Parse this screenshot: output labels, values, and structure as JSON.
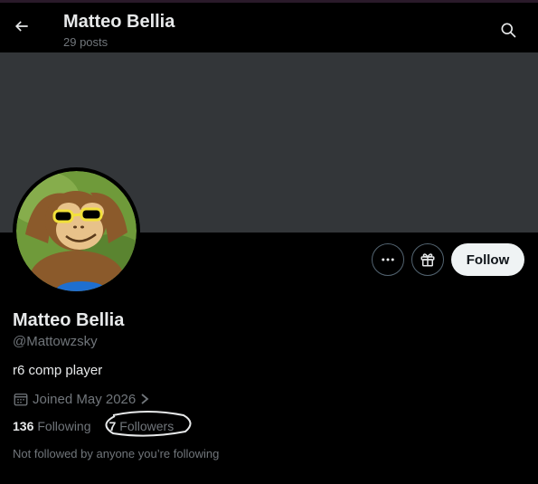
{
  "header": {
    "title": "Matteo Bellia",
    "post_count": "29 posts"
  },
  "profile": {
    "name": "Matteo Bellia",
    "handle": "@Mattowzsky",
    "bio": "r6 comp player",
    "joined": "Joined May 2026",
    "following_count": "136",
    "following_label": "Following",
    "followers_count": "7",
    "followers_label": "Followers",
    "not_followed_text": "Not followed by anyone you’re following"
  },
  "actions": {
    "follow_label": "Follow"
  },
  "icons": {
    "back": "arrow-left-icon",
    "search": "search-icon",
    "more": "more-dots-icon",
    "gift": "gift-icon",
    "calendar": "calendar-icon",
    "chevron": "chevron-right-icon"
  },
  "colors": {
    "background": "#000000",
    "banner": "#333639",
    "text_primary": "#e7e9ea",
    "text_secondary": "#71767b",
    "follow_button_bg": "#eff3f4",
    "button_border": "#536471"
  }
}
